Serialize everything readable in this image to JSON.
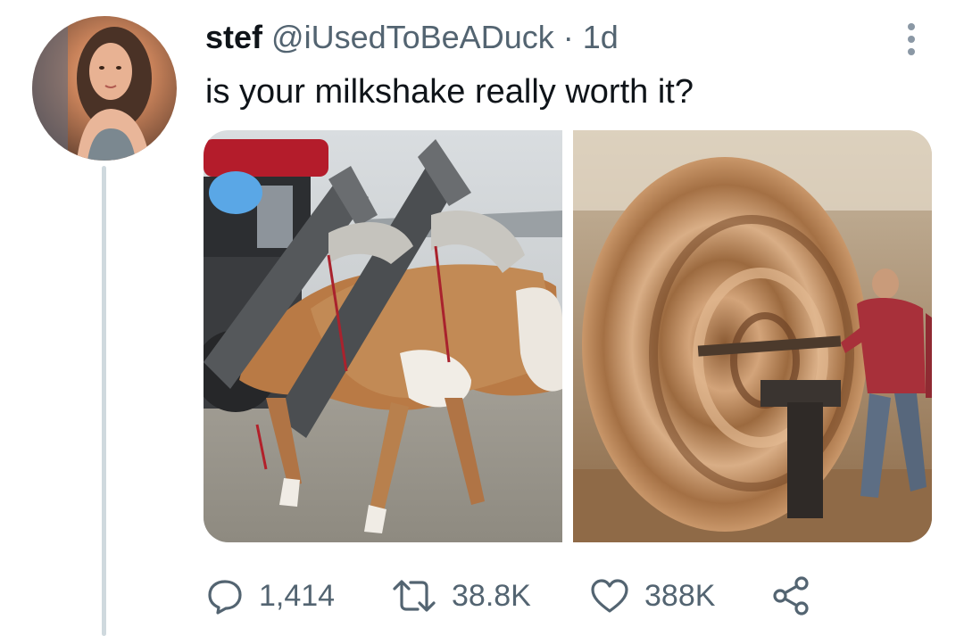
{
  "tweet": {
    "display_name": "stef",
    "handle": "@iUsedToBeADuck",
    "separator": "·",
    "time": "1d",
    "text": "is your milkshake really worth it?"
  },
  "media": {
    "count": 2,
    "left_photo": "cows-in-mechanical-harness",
    "right_photo": "man-at-spinning-lathe"
  },
  "actions": {
    "replies": "1,414",
    "retweets": "38.8K",
    "likes": "388K"
  },
  "colors": {
    "text_primary": "#0f1419",
    "text_secondary": "#536471",
    "thread_line": "#cfd9de",
    "icon": "#536471"
  },
  "icons": {
    "reply": "reply-icon",
    "retweet": "retweet-icon",
    "like": "heart-icon",
    "share": "share-icon",
    "more": "more-icon"
  }
}
